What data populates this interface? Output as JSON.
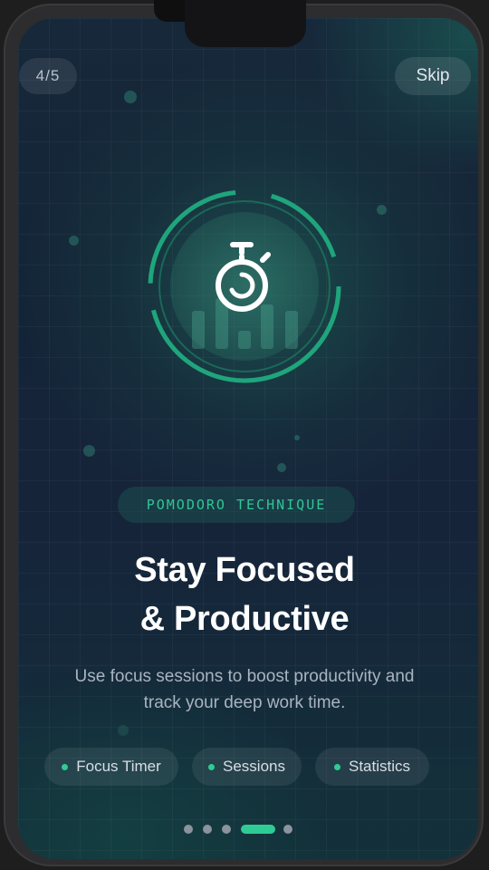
{
  "onboarding": {
    "step_indicator": "4/5",
    "skip_label": "Skip",
    "tag": "POMODORO TECHNIQUE",
    "headline_line1": "Stay Focused",
    "headline_line2": "& Productive",
    "description_line1": "Use focus sessions to boost productivity and",
    "description_line2": "track your deep work time.",
    "features": [
      {
        "label": "Focus Timer"
      },
      {
        "label": "Sessions"
      },
      {
        "label": "Statistics"
      }
    ],
    "hero_icon": "stopwatch-icon",
    "pagination": {
      "total": 5,
      "current": 4
    }
  },
  "colors": {
    "accent": "#2ecc94",
    "background": "#142437",
    "text_primary": "#ffffff",
    "text_secondary": "#aab4c0"
  }
}
